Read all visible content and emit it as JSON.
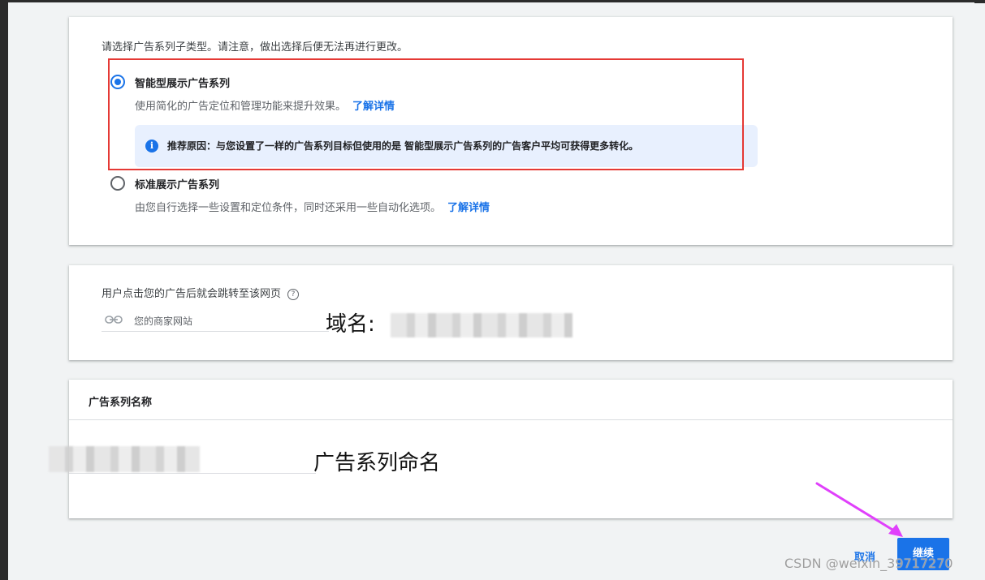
{
  "campaign_subtype": {
    "prompt": "请选择广告系列子类型。请注意，做出选择后便无法再进行更改。",
    "options": [
      {
        "title": "智能型展示广告系列",
        "description": "使用简化的广告定位和管理功能来提升效果。",
        "link": "了解详情",
        "selected": true
      },
      {
        "title": "标准展示广告系列",
        "description": "由您自行选择一些设置和定位条件，同时还采用一些自动化选项。",
        "link": "了解详情",
        "selected": false
      }
    ],
    "recommendation": "推荐原因：与您设置了一样的广告系列目标但使用的是 智能型展示广告系列的广告客户平均可获得更多转化。",
    "highlight_color": "#e53935"
  },
  "landing_page": {
    "label": "用户点击您的广告后就会跳转至该网页",
    "help_icon": "?",
    "placeholder": "您的商家网站",
    "annotation": "域名:"
  },
  "campaign_name": {
    "title": "广告系列名称",
    "annotation": "广告系列命名"
  },
  "footer": {
    "cancel": "取消",
    "continue": "继续"
  },
  "watermark": "CSDN @weixin_39717270",
  "colors": {
    "accent": "#1a73e8",
    "arrow": "#e040fb"
  }
}
